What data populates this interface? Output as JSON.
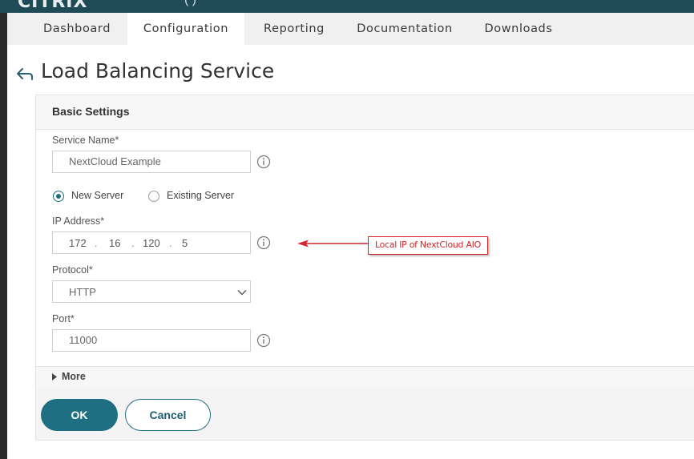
{
  "topbar": {
    "brand": "CITRIX",
    "subtitle": "(                )"
  },
  "nav": {
    "tabs": [
      {
        "label": "Dashboard"
      },
      {
        "label": "Configuration"
      },
      {
        "label": "Reporting"
      },
      {
        "label": "Documentation"
      },
      {
        "label": "Downloads"
      }
    ],
    "active_index": 1
  },
  "page": {
    "title": "Load Balancing Service"
  },
  "panel": {
    "header": "Basic Settings",
    "service_name": {
      "label": "Service Name*",
      "value": "NextCloud Example"
    },
    "server_type": {
      "new_label": "New Server",
      "existing_label": "Existing Server",
      "selected": "New Server"
    },
    "ip_address": {
      "label": "IP Address*",
      "octets": [
        "172",
        "16",
        "120",
        "5"
      ]
    },
    "protocol": {
      "label": "Protocol*",
      "value": "HTTP"
    },
    "port": {
      "label": "Port*",
      "value": "11000"
    },
    "more": "More"
  },
  "actions": {
    "ok": "OK",
    "cancel": "Cancel"
  },
  "annotation": {
    "text": "Local IP of NextCloud AIO"
  },
  "colors": {
    "accent": "#1f6f83",
    "topbar": "#1f4b57",
    "annotation": "#d3262b"
  }
}
